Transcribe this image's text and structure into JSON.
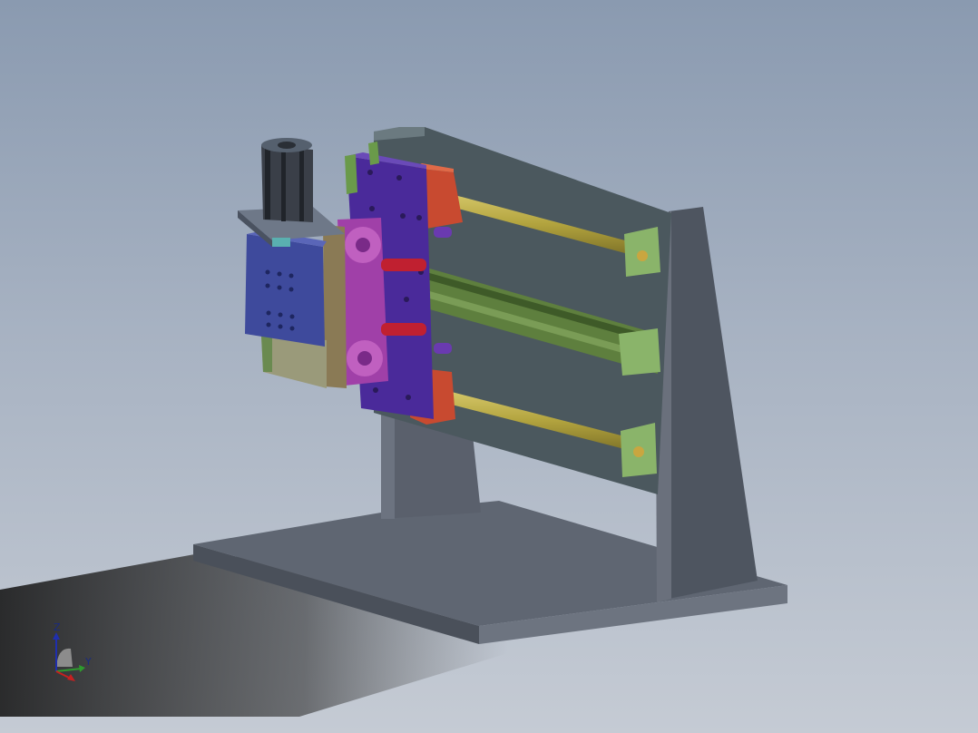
{
  "viewport": {
    "background_top": "#8a9ab0",
    "background_bottom": "#c5cbd4"
  },
  "triad": {
    "z_label": "Z",
    "y_label": "Y",
    "z_color": "#1f2fae",
    "y_color": "#2e9a2e",
    "x_color": "#c62020"
  },
  "colors": {
    "base_plate": "#5f6672",
    "back_panel": "#4b585e",
    "frame": "#6a707c",
    "guide_rod": "#b7a94a",
    "bracket": "#8ab46a",
    "rail": "#5e7f3e",
    "carriage_plate": "#4a2a9a",
    "flange": "#b050b0",
    "red_block": "#c84a30",
    "cylinder": "#3a3f48"
  }
}
